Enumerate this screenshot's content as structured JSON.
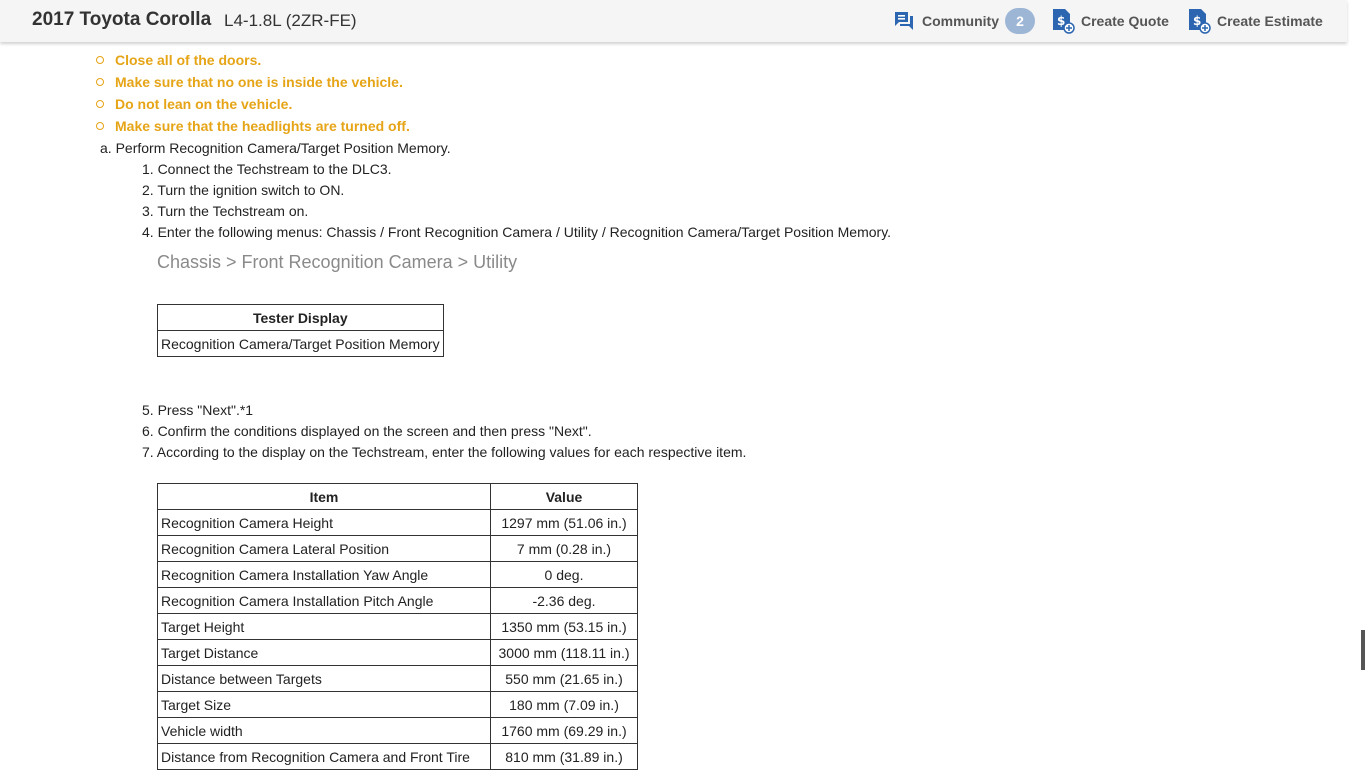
{
  "header": {
    "title_main": "2017 Toyota Corolla",
    "title_sub": "L4-1.8L (2ZR-FE)",
    "community_label": "Community",
    "community_count": "2",
    "create_quote_label": "Create Quote",
    "create_estimate_label": "Create Estimate",
    "accent_color": "#2c66b0"
  },
  "cautions": [
    "Close all of the doors.",
    "Make sure that no one is inside the vehicle.",
    "Do not lean on the vehicle.",
    "Make sure that the headlights are turned off."
  ],
  "step_a": "a. Perform Recognition Camera/Target Position Memory.",
  "steps_1": [
    "1. Connect the Techstream to the DLC3.",
    "2. Turn the ignition switch to ON.",
    "3. Turn the Techstream on.",
    "4. Enter the following menus: Chassis / Front Recognition Camera / Utility / Recognition Camera/Target Position Memory."
  ],
  "menu_path": "Chassis > Front Recognition Camera > Utility",
  "tester_table": {
    "header": "Tester Display",
    "row": "Recognition Camera/Target Position Memory"
  },
  "steps_2": [
    "5. Press \"Next\".*1",
    "6. Confirm the conditions displayed on the screen and then press \"Next\".",
    "7. According to the display on the Techstream, enter the following values for each respective item."
  ],
  "values_table": {
    "headers": [
      "Item",
      "Value"
    ],
    "rows": [
      [
        "Recognition Camera Height",
        "1297 mm (51.06 in.)"
      ],
      [
        "Recognition Camera Lateral Position",
        "7 mm (0.28 in.)"
      ],
      [
        "Recognition Camera Installation Yaw Angle",
        "0 deg."
      ],
      [
        "Recognition Camera Installation Pitch Angle",
        "-2.36 deg."
      ],
      [
        "Target Height",
        "1350 mm (53.15 in.)"
      ],
      [
        "Target Distance",
        "3000 mm (118.11 in.)"
      ],
      [
        "Distance between Targets",
        "550 mm (21.65 in.)"
      ],
      [
        "Target Size",
        "180 mm (7.09 in.)"
      ],
      [
        "Vehicle width",
        "1760 mm (69.29 in.)"
      ],
      [
        "Distance from Recognition Camera and Front Tire",
        "810 mm (31.89 in.)"
      ]
    ]
  }
}
